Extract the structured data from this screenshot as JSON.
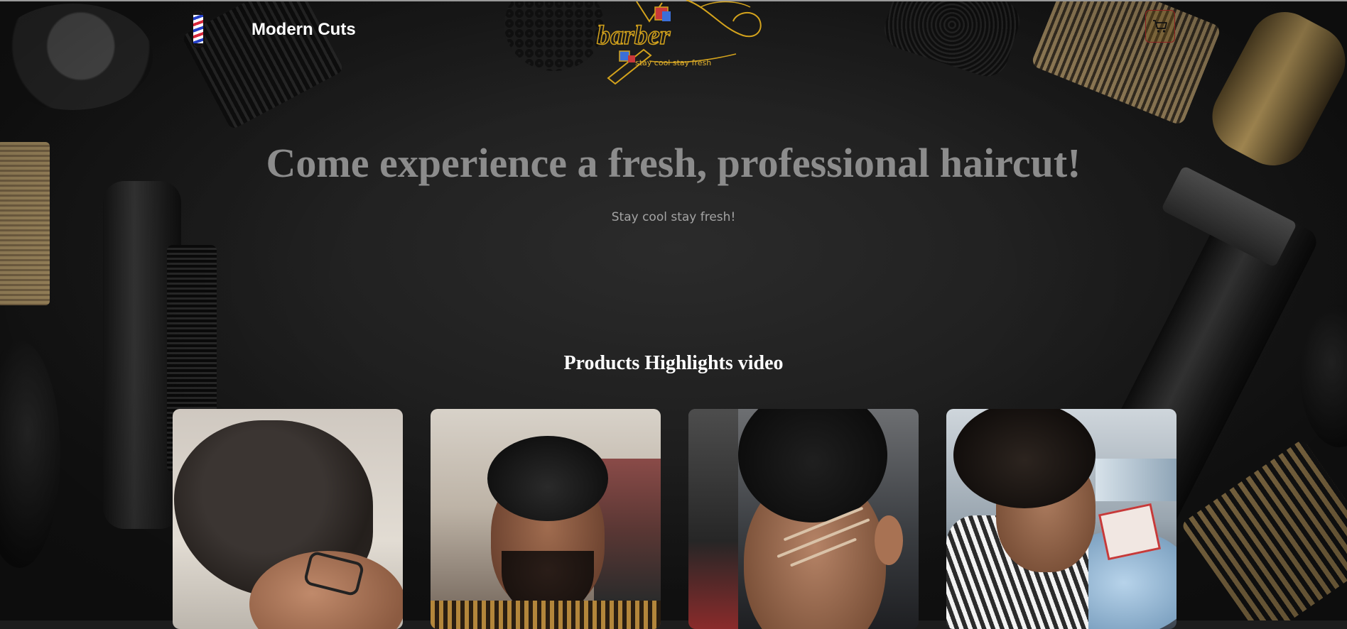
{
  "header": {
    "brand": "Modern Cuts",
    "logo_word": "barber",
    "logo_tagline": "stay cool stay fresh",
    "cart_icon": "cart-icon"
  },
  "hero": {
    "title": "Come experience a fresh, professional haircut!",
    "subtitle": "Stay cool stay fresh!"
  },
  "highlights": {
    "title": "Products Highlights video",
    "videos": [
      {
        "name": "video-1"
      },
      {
        "name": "video-2"
      },
      {
        "name": "video-3"
      },
      {
        "name": "video-4"
      }
    ]
  },
  "colors": {
    "background": "#1d1d1d",
    "logo_gold": "#d4a31c",
    "cart_border": "#8c1f1f",
    "hero_title": "#8c8c8c"
  }
}
